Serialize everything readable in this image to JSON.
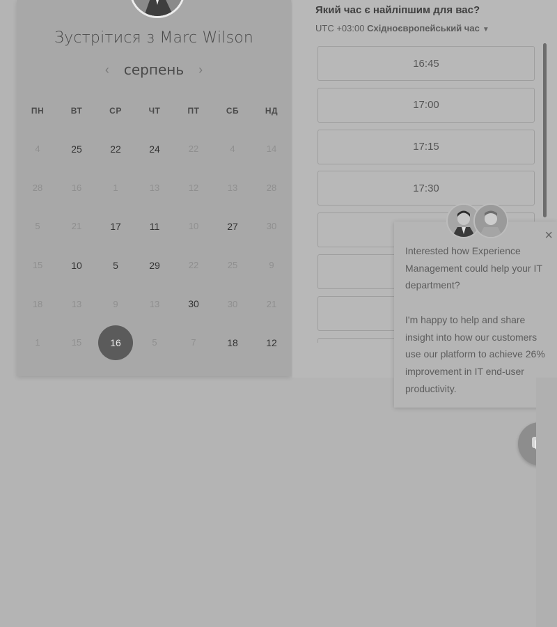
{
  "calendar": {
    "title": "Зустрітися з Marc Wilson",
    "month": "серпень",
    "weekdays": [
      "ПН",
      "ВТ",
      "СР",
      "ЧТ",
      "ПТ",
      "СБ",
      "НД"
    ],
    "weeks": [
      [
        {
          "d": "4",
          "s": "off"
        },
        {
          "d": "25",
          "s": "avail"
        },
        {
          "d": "22",
          "s": "avail"
        },
        {
          "d": "24",
          "s": "avail"
        },
        {
          "d": "22",
          "s": "off"
        },
        {
          "d": "4",
          "s": "off"
        },
        {
          "d": "14",
          "s": "off"
        }
      ],
      [
        {
          "d": "28",
          "s": "off"
        },
        {
          "d": "16",
          "s": "off"
        },
        {
          "d": "1",
          "s": "off"
        },
        {
          "d": "13",
          "s": "off"
        },
        {
          "d": "12",
          "s": "off"
        },
        {
          "d": "13",
          "s": "off"
        },
        {
          "d": "28",
          "s": "off"
        }
      ],
      [
        {
          "d": "5",
          "s": "off"
        },
        {
          "d": "21",
          "s": "off"
        },
        {
          "d": "17",
          "s": "avail"
        },
        {
          "d": "11",
          "s": "avail"
        },
        {
          "d": "10",
          "s": "off"
        },
        {
          "d": "27",
          "s": "avail"
        },
        {
          "d": "30",
          "s": "off"
        }
      ],
      [
        {
          "d": "15",
          "s": "off"
        },
        {
          "d": "10",
          "s": "avail"
        },
        {
          "d": "5",
          "s": "avail"
        },
        {
          "d": "29",
          "s": "avail"
        },
        {
          "d": "22",
          "s": "off"
        },
        {
          "d": "25",
          "s": "off"
        },
        {
          "d": "9",
          "s": "off"
        }
      ],
      [
        {
          "d": "18",
          "s": "off"
        },
        {
          "d": "13",
          "s": "off"
        },
        {
          "d": "9",
          "s": "off"
        },
        {
          "d": "13",
          "s": "off"
        },
        {
          "d": "30",
          "s": "avail"
        },
        {
          "d": "30",
          "s": "off"
        },
        {
          "d": "21",
          "s": "off"
        }
      ],
      [
        {
          "d": "1",
          "s": "off"
        },
        {
          "d": "15",
          "s": "off"
        },
        {
          "d": "16",
          "s": "sel"
        },
        {
          "d": "5",
          "s": "off"
        },
        {
          "d": "7",
          "s": "off"
        },
        {
          "d": "18",
          "s": "avail"
        },
        {
          "d": "12",
          "s": "avail"
        }
      ]
    ]
  },
  "time_panel": {
    "question": "Який час є найліпшим для вас?",
    "tz_offset": "UTC +03:00",
    "tz_name": "Східноєвропейський час",
    "slots": [
      "16:45",
      "17:00",
      "17:15",
      "17:30",
      "",
      "",
      "",
      ""
    ]
  },
  "chat": {
    "paragraph_1": "Interested how Experience Management could help your IT department?",
    "paragraph_2": "I'm happy to help and share insight into how our customers use our platform to achieve 26% improvement in IT end-user productivity.",
    "close_glyph": "×"
  }
}
